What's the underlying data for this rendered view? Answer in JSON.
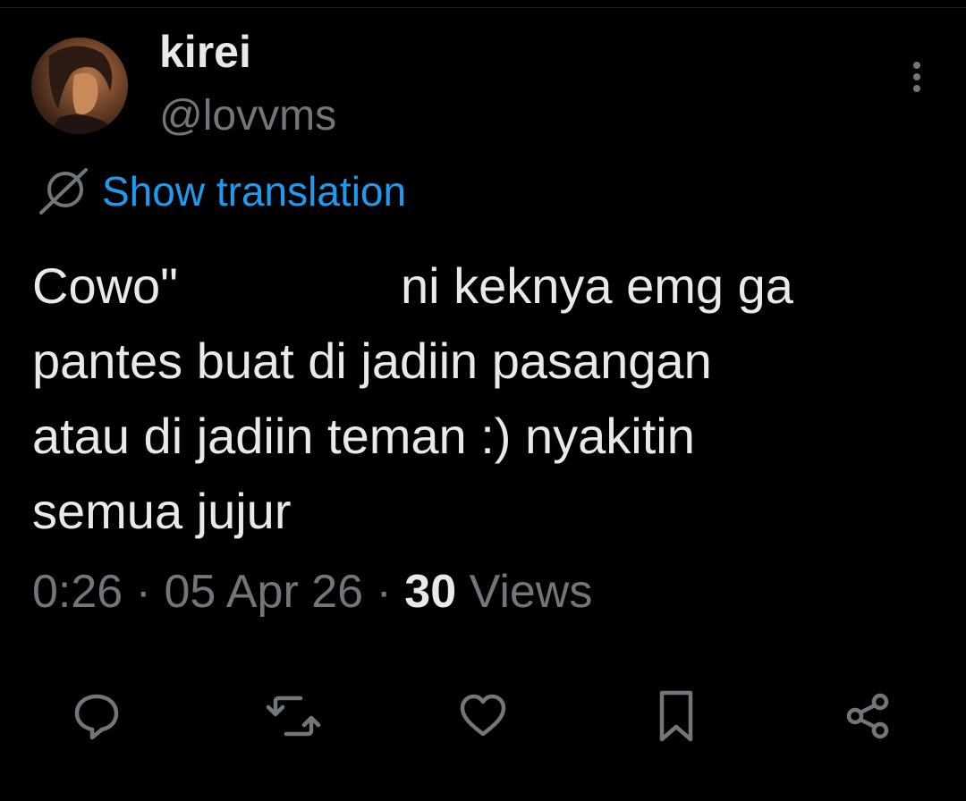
{
  "tweet": {
    "display_name": "kirei",
    "handle": "@lovvms",
    "show_translation_label": "Show translation",
    "text_lines": [
      "Cowo\"                ni keknya emg ga",
      "pantes buat di jadiin pasangan",
      "atau di jadiin teman :) nyakitin",
      "semua jujur"
    ],
    "time": "0:26",
    "date": "05 Apr 26",
    "views_count": "30",
    "views_label": "Views"
  },
  "icons": {
    "more": "more-vertical-icon",
    "translate": "globe-icon",
    "reply": "reply-icon",
    "repost": "repost-icon",
    "like": "heart-icon",
    "bookmark": "bookmark-icon",
    "share": "share-icon"
  },
  "colors": {
    "background": "#000000",
    "text_primary": "#e7e9ea",
    "text_secondary": "#71767b",
    "link": "#1d9bf0"
  }
}
